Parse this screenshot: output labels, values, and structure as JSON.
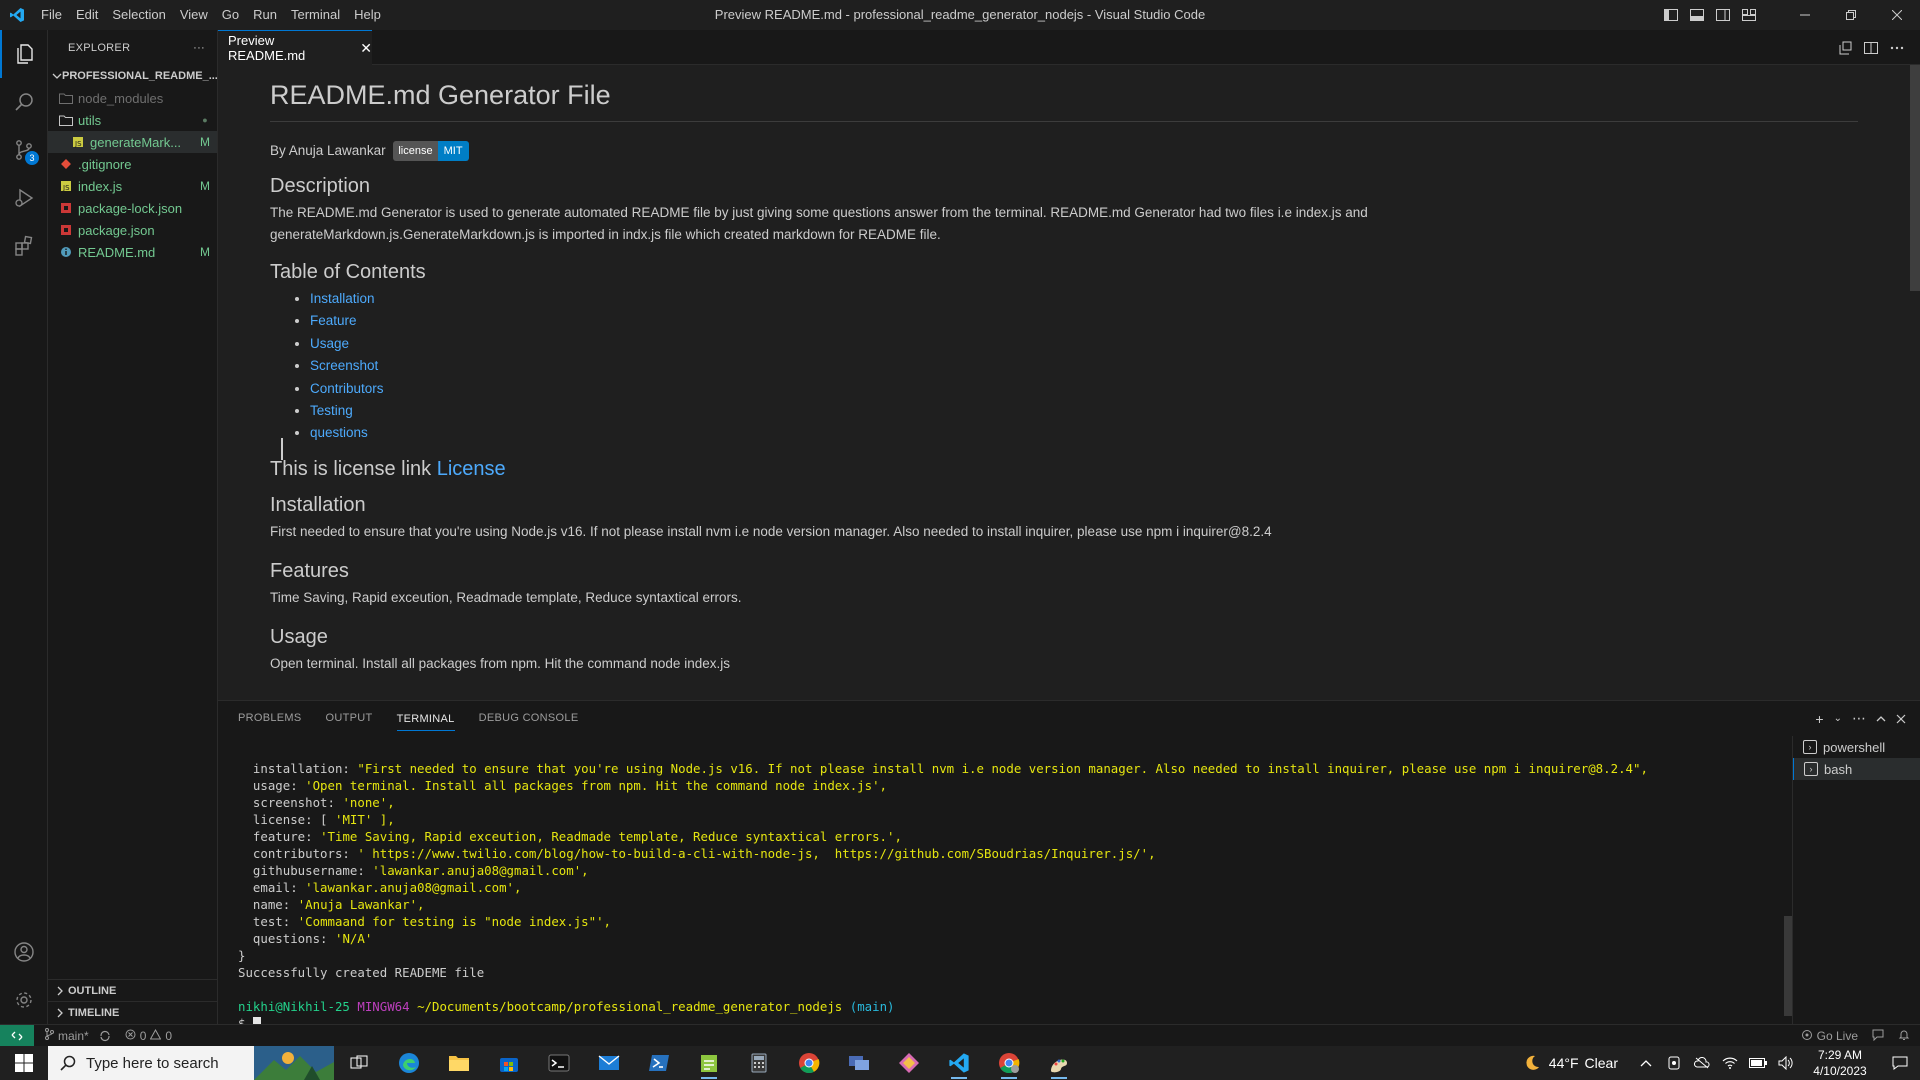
{
  "window": {
    "title": "Preview README.md - professional_readme_generator_nodejs - Visual Studio Code",
    "menu": [
      "File",
      "Edit",
      "Selection",
      "View",
      "Go",
      "Run",
      "Terminal",
      "Help"
    ]
  },
  "activity": {
    "source_control_badge": "3"
  },
  "sidebar": {
    "header": "EXPLORER",
    "more": "···",
    "root": "PROFESSIONAL_README_...",
    "items": [
      {
        "label": "node_modules",
        "badge": "",
        "kind": "folder",
        "color": "#6f6f6f"
      },
      {
        "label": "utils",
        "badge": "●",
        "kind": "folder",
        "color": "#73c991"
      },
      {
        "label": "generateMark...",
        "badge": "M",
        "kind": "js",
        "color": "#73c991"
      },
      {
        "label": ".gitignore",
        "badge": "",
        "kind": "git",
        "color": "#73c991"
      },
      {
        "label": "index.js",
        "badge": "M",
        "kind": "js",
        "color": "#73c991"
      },
      {
        "label": "package-lock.json",
        "badge": "",
        "kind": "json",
        "color": "#73c991"
      },
      {
        "label": "package.json",
        "badge": "",
        "kind": "json",
        "color": "#73c991"
      },
      {
        "label": "README.md",
        "badge": "M",
        "kind": "info",
        "color": "#73c991"
      }
    ],
    "outline": "OUTLINE",
    "timeline": "TIMELINE"
  },
  "editor": {
    "tab_label": "Preview README.md",
    "tab_close": "✕"
  },
  "preview": {
    "h1": "README.md Generator File",
    "byline": "By Anuja Lawankar",
    "badge_left": "license",
    "badge_right": "MIT",
    "description_heading": "Description",
    "description_text": "The README.md Generator is used to generate automated README file by just giving some questions answer from the terminal. README.md Generator had two files i.e index.js and generateMarkdown.js.GenerateMarkdown.js is imported in indx.js file which created markdown for README file.",
    "toc_heading": "Table of Contents",
    "toc": [
      "Installation",
      "Feature",
      "Usage",
      "Screenshot",
      "Contributors",
      "Testing",
      "questions"
    ],
    "license_heading_prefix": "This is license link ",
    "license_link": "License",
    "installation_heading": "Installation",
    "installation_text": "First needed to ensure that you're using Node.js v16. If not please install nvm i.e node version manager. Also needed to install inquirer, please use npm i inquirer@8.2.4",
    "features_heading": "Features",
    "features_text": "Time Saving, Rapid exceution, Readmade template, Reduce syntaxtical errors.",
    "usage_heading": "Usage",
    "usage_text_partial": "Open terminal. Install all packages from npm. Hit the command node index.js"
  },
  "panel": {
    "tabs": [
      "PROBLEMS",
      "OUTPUT",
      "TERMINAL",
      "DEBUG CONSOLE"
    ],
    "terminals": [
      "powershell",
      "bash"
    ],
    "lines": [
      {
        "key": "  installation: ",
        "value": "\"First needed to ensure that you're using Node.js v16. If not please install nvm i.e node version manager. Also needed to install inquirer, please use npm i inquirer@8.2.4\","
      },
      {
        "key": "  usage: ",
        "value": "'Open terminal. Install all packages from npm. Hit the command node index.js',"
      },
      {
        "key": "  screenshot: ",
        "value": "'none',"
      },
      {
        "key": "  license: [ ",
        "value": "'MIT' ],"
      },
      {
        "key": "  feature: ",
        "value": "'Time Saving, Rapid exceution, Readmade template, Reduce syntaxtical errors.',"
      },
      {
        "key": "  contributors: ",
        "value": "' https://www.twilio.com/blog/how-to-build-a-cli-with-node-js,  https://github.com/SBoudrias/Inquirer.js/',"
      },
      {
        "key": "  githubusername: ",
        "value": "'lawankar.anuja08@gmail.com',"
      },
      {
        "key": "  email: ",
        "value": "'lawankar.anuja08@gmail.com',"
      },
      {
        "key": "  name: ",
        "value": "'Anuja Lawankar',"
      },
      {
        "key": "  test: ",
        "value": "'Commaand for testing is \"node index.js\"',"
      },
      {
        "key": "  questions: ",
        "value": "'N/A'"
      }
    ],
    "close_brace": "}",
    "success": "Successfully created READEME file",
    "prompt_user": "nikhi@Nikhil-25",
    "prompt_host": "MINGW64",
    "prompt_path": "~/Documents/bootcamp/professional_readme_generator_nodejs",
    "prompt_branch": "(main)",
    "prompt_symbol": "$"
  },
  "status": {
    "branch": "main*",
    "errors": "0",
    "warnings": "0",
    "go_live": "Go Live"
  },
  "taskbar": {
    "search_placeholder": "Type here to search",
    "weather_temp": "44°F",
    "weather_text": "Clear",
    "time": "7:29 AM",
    "date": "4/10/2023"
  }
}
